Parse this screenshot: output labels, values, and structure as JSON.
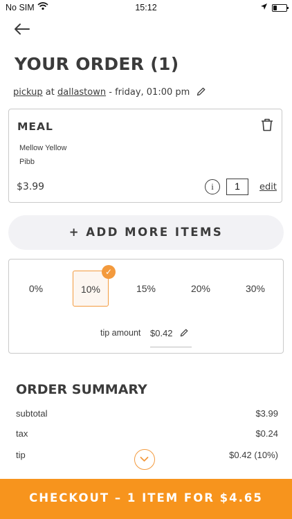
{
  "status_bar": {
    "carrier": "No SIM",
    "time": "15:12"
  },
  "header": {
    "title": "YOUR ORDER (1)"
  },
  "order_info": {
    "method": "pickup",
    "at_word": "at",
    "location": "dallastown",
    "when": "- friday, 01:00 pm"
  },
  "item": {
    "name": "MEAL",
    "modifiers": [
      "Mellow Yellow",
      "Pibb"
    ],
    "price": "$3.99",
    "info_glyph": "i",
    "quantity": "1",
    "edit_label": "edit"
  },
  "add_more_label": "+ ADD MORE ITEMS",
  "tip": {
    "options": [
      "0%",
      "10%",
      "15%",
      "20%",
      "30%"
    ],
    "selected": "10%",
    "check_glyph": "✓",
    "amount_label": "tip amount",
    "amount_value": "$0.42"
  },
  "summary": {
    "title": "ORDER SUMMARY",
    "rows": [
      {
        "label": "subtotal",
        "value": "$3.99"
      },
      {
        "label": "tax",
        "value": "$0.24"
      },
      {
        "label": "tip",
        "value": "$0.42 (10%)"
      }
    ]
  },
  "checkout_label": "CHECKOUT – 1 ITEM FOR $4.65",
  "colors": {
    "accent": "#f7941d",
    "text": "#3b3b3b",
    "border": "#c9c9c9",
    "pill_bg": "#f2f2f5"
  },
  "icons": [
    "wifi-icon",
    "location-arrow-icon",
    "battery-icon",
    "back-arrow-icon",
    "pencil-icon",
    "trash-icon",
    "info-icon",
    "check-icon",
    "chevron-down-icon"
  ]
}
